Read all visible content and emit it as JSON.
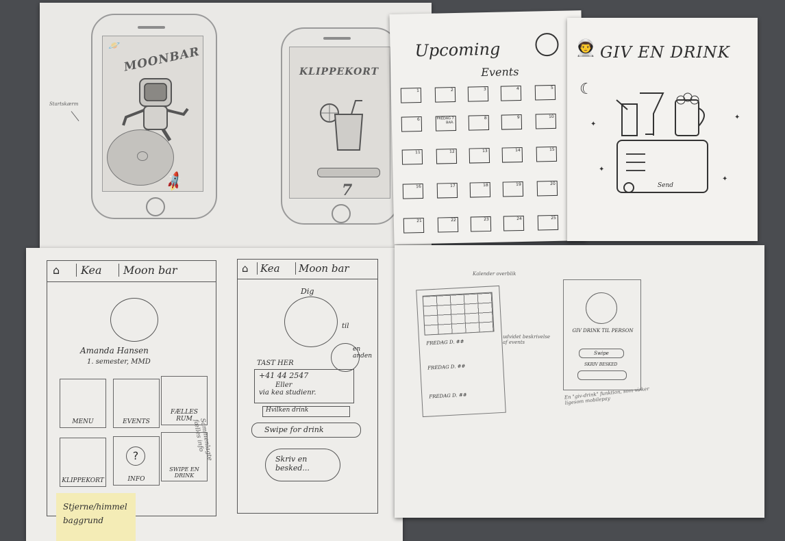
{
  "sketch1": {
    "title": "MOONBAR",
    "side_note": "Startskærm"
  },
  "sketch2": {
    "title": "KLIPPEKORT",
    "count": "7"
  },
  "sketch3": {
    "title_line1": "Upcoming",
    "title_line2": "Events",
    "cells": [
      "1",
      "2",
      "3",
      "4",
      "5",
      "6",
      "FREDAG 7 BAR.",
      "8",
      "9",
      "10",
      "11",
      "12",
      "13",
      "14",
      "15",
      "16",
      "17",
      "18",
      "19",
      "20",
      "21",
      "22",
      "23",
      "24",
      "25"
    ]
  },
  "sketch4": {
    "title": "GIV EN DRINK",
    "send": "Send"
  },
  "nav": {
    "home": "⌂",
    "kea": "Kea",
    "moonbar": "Moon bar"
  },
  "profile": {
    "name": "Amanda Hansen",
    "subtitle": "1. semester, MMD",
    "tiles": [
      "MENU",
      "EVENTS",
      "FÆLLES RUM",
      "KLIPPEKORT",
      "INFO",
      "SWIPE EN DRINK"
    ],
    "side_note": "Sammenlagte fælles info"
  },
  "drink": {
    "dig": "Dig",
    "til": "til",
    "en_anden": "en anden",
    "tast_her": "TAST HER",
    "phone": "+41 44 2547",
    "eller": "Eller",
    "via": "via kea studienr.",
    "select": "Hvilken drink",
    "swipe": "Swipe for drink",
    "message": "Skriv en besked..."
  },
  "events_sketch": {
    "note_top": "Kalender overblik",
    "note_side": "udvidet beskrivelse af events",
    "rows": [
      "FREDAG D. ##",
      "FREDAG D. ##",
      "FREDAG D. ##"
    ]
  },
  "givdrink_sketch": {
    "title": "GIV DRINK TIL PERSON",
    "swipe": "Swipe",
    "field": "SKRIV BESKED",
    "note": "En \"giv-drink\" funktion, som virker ligesom mobilepay"
  },
  "sticky": {
    "text": "Stjerne/himmel baggrund"
  }
}
